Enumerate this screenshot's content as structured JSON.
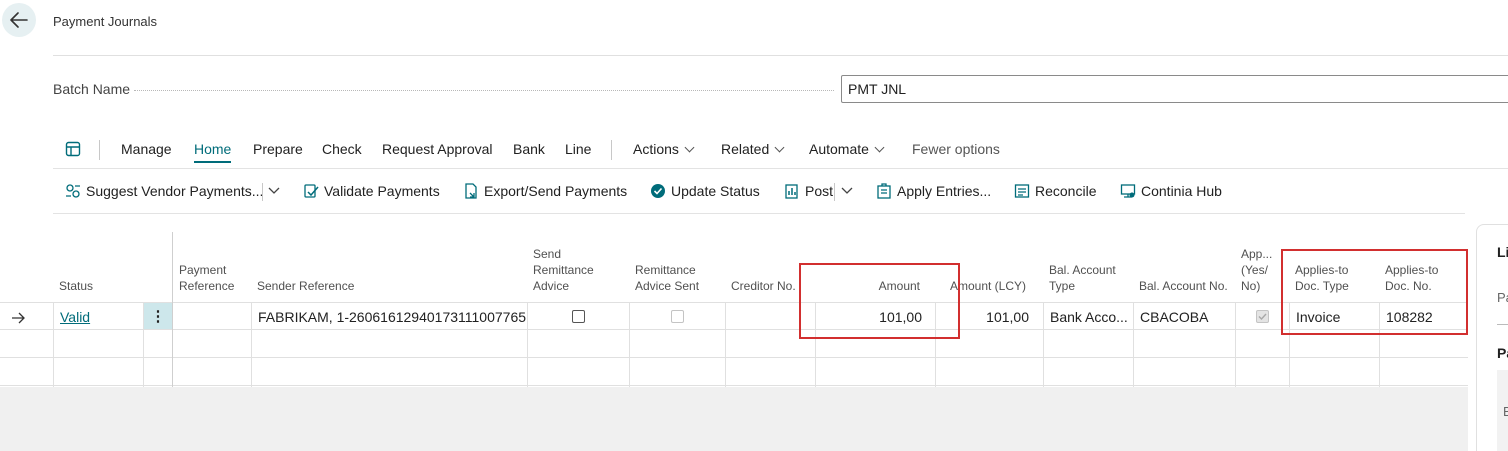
{
  "page": {
    "title": "Payment Journals"
  },
  "batch": {
    "label": "Batch Name",
    "value": "PMT JNL"
  },
  "menu": {
    "items": [
      "Manage",
      "Home",
      "Prepare",
      "Check",
      "Request Approval",
      "Bank",
      "Line"
    ],
    "dropdowns": [
      "Actions",
      "Related",
      "Automate"
    ],
    "fewer": "Fewer options"
  },
  "actions": {
    "suggest": "Suggest Vendor Payments...",
    "validate": "Validate Payments",
    "export": "Export/Send Payments",
    "update": "Update Status",
    "post": "Post",
    "apply": "Apply Entries...",
    "reconcile": "Reconcile",
    "continia": "Continia Hub"
  },
  "columns": {
    "status": "Status",
    "payment_reference": "Payment Reference",
    "sender_reference": "Sender Reference",
    "send_remittance": "Send Remittance Advice",
    "remittance_sent": "Remittance Advice Sent",
    "creditor_no": "Creditor No.",
    "amount": "Amount",
    "amount_lcy": "Amount (LCY)",
    "bal_account_type": "Bal. Account Type",
    "bal_account_no": "Bal. Account No.",
    "applied": "App... (Yes/ No)",
    "applies_to_doc_type": "Applies-to Doc. Type",
    "applies_to_doc_no": "Applies-to Doc. No."
  },
  "rows": [
    {
      "status": "Valid",
      "payment_reference": "",
      "sender_reference": "FABRIKAM, 1-26061612940173111007765",
      "send_remittance": false,
      "remittance_sent": false,
      "creditor_no": "",
      "amount": "101,00",
      "amount_lcy": "101,00",
      "bal_account_type": "Bank Acco...",
      "bal_account_no": "CBACOBA",
      "applied": true,
      "applies_to_doc_type": "Invoice",
      "applies_to_doc_no": "108282"
    }
  ],
  "side_panel": {
    "heading_1": "Li",
    "sub_1": "Pa",
    "heading_2": "Pa",
    "sub_2": "B"
  },
  "colors": {
    "accent": "#006c7a",
    "highlight": "#d22f2f",
    "selected_cell": "#cde7eb"
  }
}
